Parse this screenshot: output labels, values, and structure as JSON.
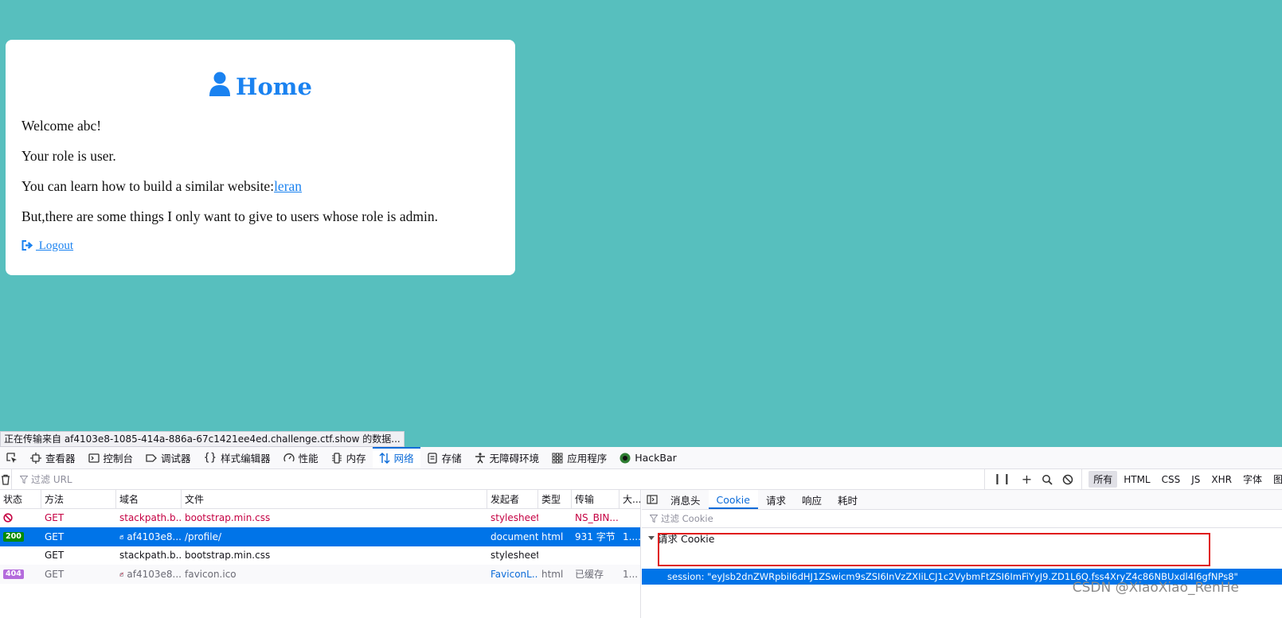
{
  "page": {
    "title": "Home",
    "lines": {
      "welcome": "Welcome abc!",
      "role": "Your role is user.",
      "learn_prefix": "You can learn how to build a similar website:",
      "learn_link": "leran",
      "admin_note": "But,there are some things I only want to give to users whose role is admin."
    },
    "logout_label": " Logout",
    "accent_color": "#1a82f0",
    "background_color": "#57bfbe"
  },
  "status_bar": "正在传输来自 af4103e8-1085-414a-886a-67c1421ee4ed.challenge.ctf.show 的数据...",
  "devtools": {
    "tabs": [
      {
        "label": "查看器",
        "icon": "inspector-icon"
      },
      {
        "label": "控制台",
        "icon": "console-icon"
      },
      {
        "label": "调试器",
        "icon": "debugger-icon"
      },
      {
        "label": "样式编辑器",
        "icon": "style-editor-icon"
      },
      {
        "label": "性能",
        "icon": "performance-icon"
      },
      {
        "label": "内存",
        "icon": "memory-icon"
      },
      {
        "label": "网络",
        "icon": "network-icon",
        "active": true
      },
      {
        "label": "存储",
        "icon": "storage-icon"
      },
      {
        "label": "无障碍环境",
        "icon": "accessibility-icon"
      },
      {
        "label": "应用程序",
        "icon": "application-icon"
      },
      {
        "label": "HackBar",
        "icon": "hackbar-icon"
      }
    ],
    "url_filter_placeholder": "过滤 URL",
    "type_filters": [
      "所有",
      "HTML",
      "CSS",
      "JS",
      "XHR",
      "字体",
      "图"
    ],
    "columns": [
      "状态",
      "方法",
      "域名",
      "文件",
      "发起者",
      "类型",
      "传输",
      "大..."
    ],
    "requests": [
      {
        "status": "",
        "method": "GET",
        "domain": "stackpath.b...",
        "file": "bootstrap.min.css",
        "initiator": "stylesheet",
        "type": "",
        "transferred": "NS_BIN...",
        "size": ""
      },
      {
        "status": "200",
        "method": "GET",
        "domain": "af4103e8...",
        "file": "/profile/",
        "initiator": "document",
        "type": "html",
        "transferred": "931 字节",
        "size": "1...."
      },
      {
        "status": "",
        "method": "GET",
        "domain": "stackpath.b...",
        "file": "bootstrap.min.css",
        "initiator": "stylesheet",
        "type": "",
        "transferred": "",
        "size": ""
      },
      {
        "status": "404",
        "method": "GET",
        "domain": "af4103e8...",
        "file": "favicon.ico",
        "initiator": "FaviconL...",
        "type": "html",
        "transferred": "已缓存",
        "size": "1..."
      }
    ],
    "side_tabs": [
      "消息头",
      "Cookie",
      "请求",
      "响应",
      "耗时"
    ],
    "cookie_filter_placeholder": "过滤 Cookie",
    "section_title": "请求 Cookie",
    "cookie": {
      "name": "session",
      "value": "\"eyJsb2dnZWRpbiI6dHJ1ZSwicm9sZSI6InVzZXIiLCJ1c2VybmFtZSI6ImFiYyJ9.ZD1L6Q.fss4XryZ4c86NBUxdl4l6gfNPs8\""
    },
    "status_colors": {
      "ok": "#058b00",
      "not_found": "#b46bdc",
      "selected": "#0074e8"
    }
  },
  "watermark": "CSDN @XiaoXiao_RenHe"
}
